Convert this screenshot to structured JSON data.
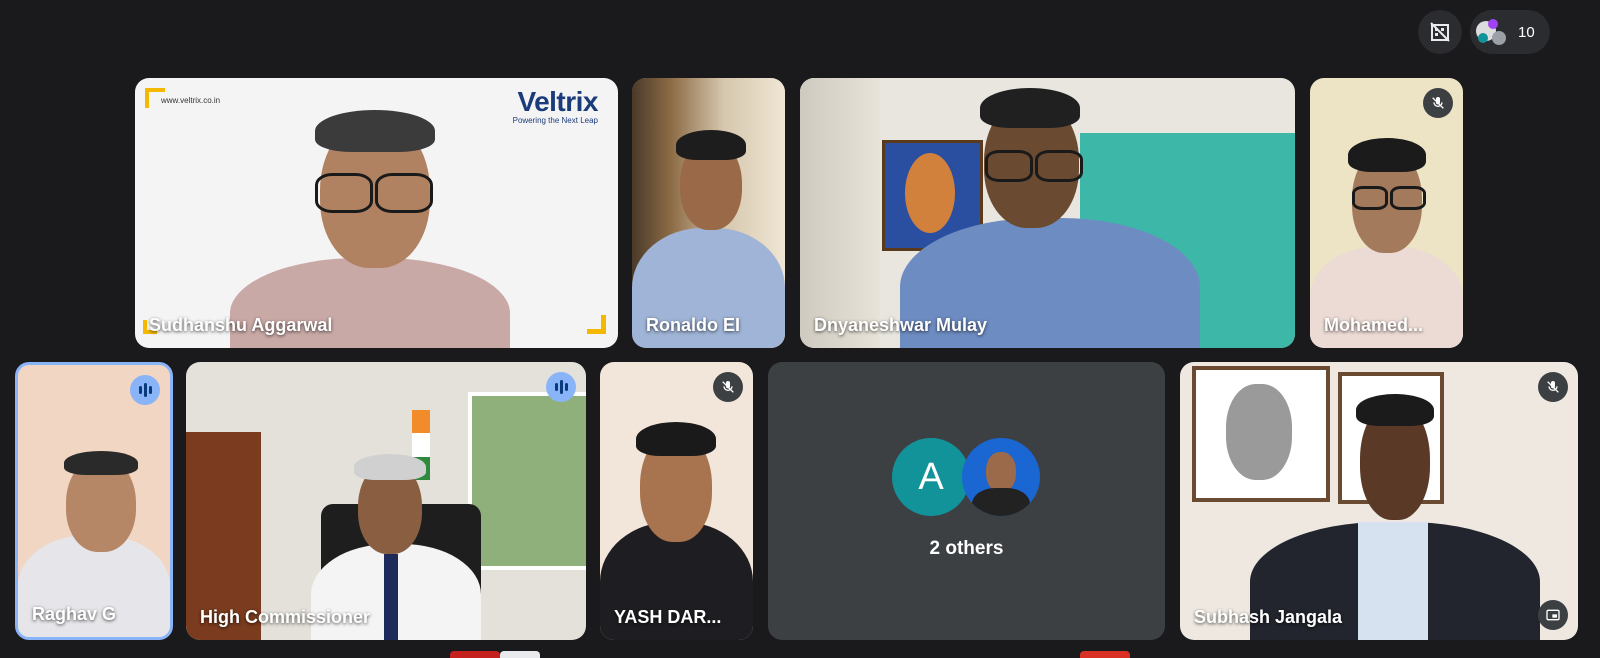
{
  "participants_count": "10",
  "tiles": [
    {
      "name": "Sudhanshu Aggarwal",
      "speaking": false,
      "muted": false,
      "logo": {
        "text": "Veltrix",
        "tagline": "Powering the Next Leap",
        "url": "www.veltrix.co.in"
      }
    },
    {
      "name": "Ronaldo EI",
      "muted": false
    },
    {
      "name": "Dnyaneshwar Mulay",
      "muted": false
    },
    {
      "name": "Mohamed...",
      "muted": true
    },
    {
      "name": "Raghav G",
      "speaking": true
    },
    {
      "name": "High Commissioner",
      "speaking": true
    },
    {
      "name": "YASH DAR...",
      "muted": true
    },
    {
      "name": "Subhash Jangala",
      "muted": true
    }
  ],
  "others": {
    "avatar_letter": "A",
    "label": "2 others"
  },
  "colors": {
    "speaking_border": "#8ab4f8",
    "avatar_teal": "#12939a"
  }
}
